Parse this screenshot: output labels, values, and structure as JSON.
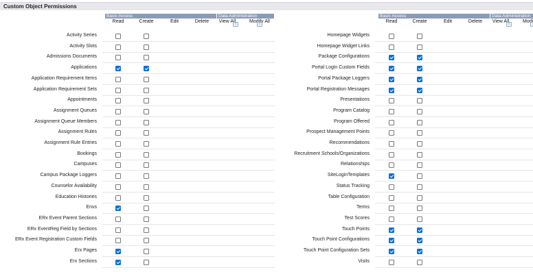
{
  "section_title": "Custom Object Permissions",
  "groups": {
    "basic_access": "Basic Access",
    "data_administration": "Data Administration"
  },
  "columns": [
    "Read",
    "Create",
    "Edit",
    "Delete",
    "View All",
    "Modify All"
  ],
  "help_glyph": "i",
  "left_rows": [
    {
      "label": "Activity Series",
      "read": false,
      "create": false
    },
    {
      "label": "Activity Slots",
      "read": false,
      "create": false
    },
    {
      "label": "Admissions Documents",
      "read": false,
      "create": false
    },
    {
      "label": "Applications",
      "read": true,
      "create": true
    },
    {
      "label": "Application Requirement Items",
      "read": false,
      "create": false
    },
    {
      "label": "Application Requirement Sets",
      "read": false,
      "create": false
    },
    {
      "label": "Appointments",
      "read": false,
      "create": false
    },
    {
      "label": "Assignment Queues",
      "read": false,
      "create": false
    },
    {
      "label": "Assignment Queue Members",
      "read": false,
      "create": false
    },
    {
      "label": "Assignment Rules",
      "read": false,
      "create": false
    },
    {
      "label": "Assignment Rule Entries",
      "read": false,
      "create": false
    },
    {
      "label": "Bookings",
      "read": false,
      "create": false
    },
    {
      "label": "Campuses",
      "read": false,
      "create": false
    },
    {
      "label": "Campus Package Loggers",
      "read": false,
      "create": false
    },
    {
      "label": "Counselor Availability",
      "read": false,
      "create": false
    },
    {
      "label": "Education Histories",
      "read": false,
      "create": false
    },
    {
      "label": "Envs",
      "read": true,
      "create": false
    },
    {
      "label": "ERx Event Parent Sections",
      "read": false,
      "create": false
    },
    {
      "label": "ERx EventReg Field by Sections",
      "read": false,
      "create": false
    },
    {
      "label": "ERx Event Registration Custom Fields",
      "read": false,
      "create": false
    },
    {
      "label": "Erx Pages",
      "read": true,
      "create": false
    },
    {
      "label": "Erx Sections",
      "read": true,
      "create": false
    }
  ],
  "right_rows": [
    {
      "label": "Homepage Widgets",
      "read": false,
      "create": false
    },
    {
      "label": "Homepage Widget Links",
      "read": false,
      "create": false
    },
    {
      "label": "Package Configurations",
      "read": true,
      "create": true
    },
    {
      "label": "Portal Login Custom Fields",
      "read": true,
      "create": true
    },
    {
      "label": "Portal Package Loggers",
      "read": true,
      "create": true
    },
    {
      "label": "Portal Registration Messages",
      "read": true,
      "create": true
    },
    {
      "label": "Presentations",
      "read": false,
      "create": false
    },
    {
      "label": "Program Catalog",
      "read": false,
      "create": false
    },
    {
      "label": "Program Offered",
      "read": false,
      "create": false
    },
    {
      "label": "Prospect Management Points",
      "read": false,
      "create": false
    },
    {
      "label": "Recommendations",
      "read": false,
      "create": false
    },
    {
      "label": "Recruitment Schools/Organizations",
      "read": false,
      "create": false
    },
    {
      "label": "Relationships",
      "read": false,
      "create": false
    },
    {
      "label": "SiteLoginTemplates",
      "read": true,
      "create": false
    },
    {
      "label": "Status Tracking",
      "read": false,
      "create": false
    },
    {
      "label": "Table Configuration",
      "read": false,
      "create": false
    },
    {
      "label": "Terms",
      "read": false,
      "create": false
    },
    {
      "label": "Test Scores",
      "read": false,
      "create": false
    },
    {
      "label": "Touch Points",
      "read": true,
      "create": true
    },
    {
      "label": "Touch Point Configurations",
      "read": true,
      "create": true
    },
    {
      "label": "Touch Point Configuration Sets",
      "read": true,
      "create": true
    },
    {
      "label": "Visits",
      "read": false,
      "create": false
    }
  ]
}
